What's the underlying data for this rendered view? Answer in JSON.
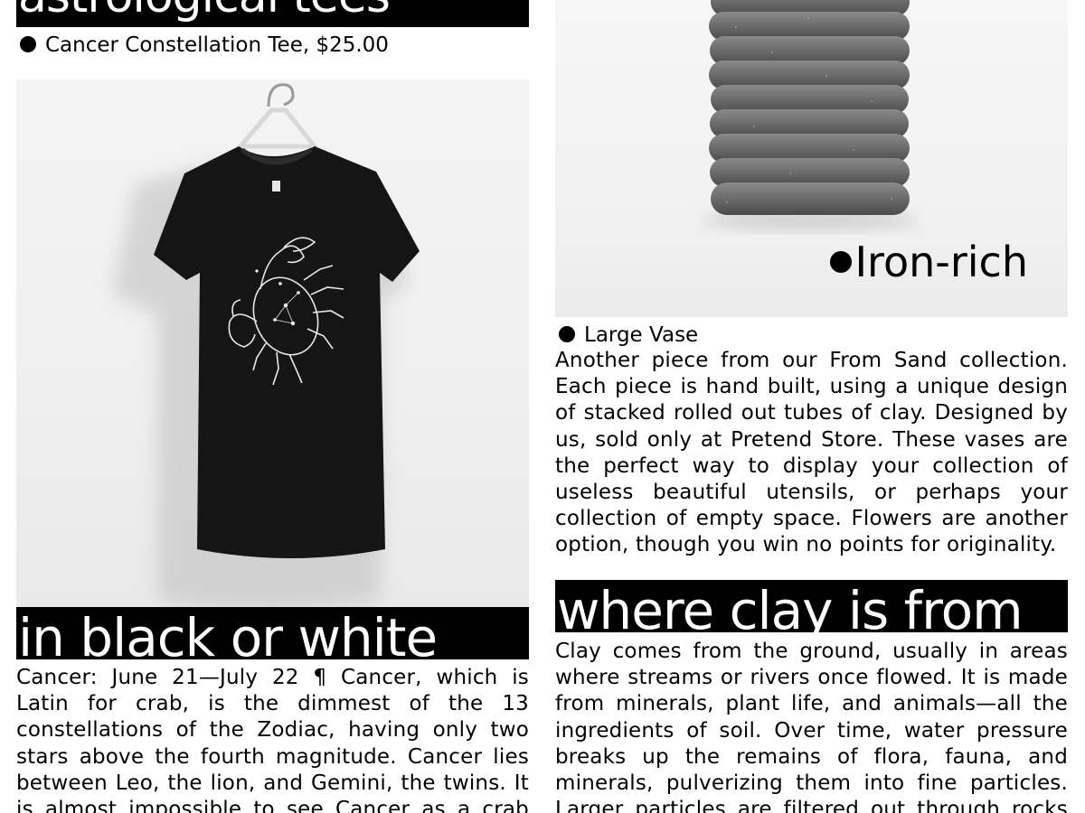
{
  "left": {
    "top_heading": "astrological tees",
    "product_caption": "Cancer Constellation Tee, $25.00",
    "section_heading": "in black or white",
    "description": "Cancer: June 21—July 22 ¶ Cancer, which is Latin for crab, is the dimmest of the 13 constellations of the Zodiac, having only two stars above the fourth magnitude. Cancer lies between Leo, the lion, and Gemini, the twins. It is almost impossible to see Cancer as a crab"
  },
  "right": {
    "image_label": "Iron-rich",
    "product_caption": "Large Vase",
    "description": "Another piece from our From Sand collection. Each piece is hand built, using a unique design of stacked rolled out tubes of clay. Designed by us, sold only at Pretend Store. These vases are the perfect way to display your collection of useless beautiful utensils, or perhaps your collection of empty space. Flowers are another option, though you win no points for originality.",
    "section_heading": "where clay is from",
    "section_text": "Clay comes from the ground, usually in areas where streams or rivers once flowed. It is made from minerals, plant life, and animals—all the ingredients of soil. Over time, water pressure breaks up the remains of flora, fauna, and minerals, pulverizing them into fine particles. Larger particles are filtered out through rocks"
  },
  "colors": {
    "ink": "#000000",
    "paper": "#ffffff"
  }
}
